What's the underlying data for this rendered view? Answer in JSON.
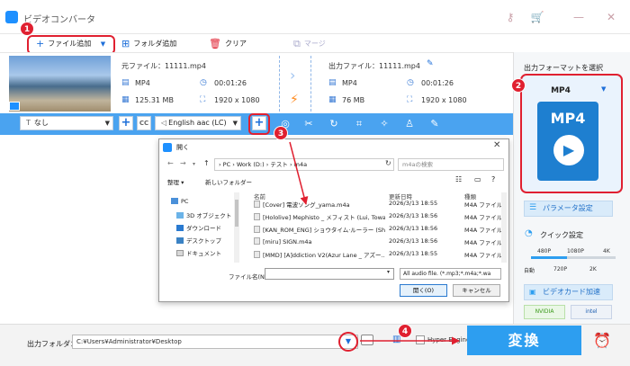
{
  "app": {
    "title": "ビデオコンバータ"
  },
  "window": {
    "minimize": "—",
    "close": "✕"
  },
  "toolbar": {
    "add_file": "ファイル追加",
    "add_folder": "フォルダ追加",
    "clear": "クリア",
    "merge": "マージ"
  },
  "file": {
    "source_label": "元ファイル：11111.mp4",
    "source_format": "MP4",
    "source_duration": "00:01:26",
    "source_size": "125.31 MB",
    "source_resolution": "1920 x 1080",
    "output_label": "出力ファイル：11111.mp4",
    "output_format": "MP4",
    "output_duration": "00:01:26",
    "output_size": "76 MB",
    "output_resolution": "1920 x 1080"
  },
  "editbar": {
    "subtitle": "なし",
    "audio": "English aac (LC)",
    "cc": "CC"
  },
  "output": {
    "folder_label": "出力フォルダ：",
    "path": "C:¥Users¥Administrator¥Desktop",
    "hw_label": "Hyper Engine",
    "convert": "変換"
  },
  "right": {
    "format_title": "出力フォーマットを選択",
    "format_name": "MP4",
    "format_badge": "MP4",
    "param": "パラメータ設定",
    "quick": "クイック設定",
    "ticks_top": [
      "480P",
      "1080P",
      "4K"
    ],
    "ticks_bottom": [
      "自動",
      "720P",
      "2K"
    ],
    "accel": "ビデオカード加速",
    "nvidia": "NVIDIA",
    "intel": "intel"
  },
  "steps": [
    "1",
    "2",
    "3",
    "4"
  ],
  "dialog": {
    "title": "開く",
    "address": "›  PC  ›  Work (D:)  ›  テスト  ›  m4a",
    "search_placeholder": "m4aの検索",
    "organize": "整理 ▾",
    "new_folder": "新しいフォルダー",
    "tree": [
      "PC",
      "3D オブジェクト",
      "ダウンロード",
      "デスクトップ",
      "ドキュメント"
    ],
    "columns": {
      "name": "名前",
      "date": "更新日時",
      "type": "種類"
    },
    "files": [
      {
        "name": "[Cover] 電波ソング_yama.m4a",
        "date": "2026/3/13 18:55",
        "type": "M4A ファイル"
      },
      {
        "name": "[Hololive] Mephisto _ メフィスト (Lui, Towa...",
        "date": "2026/3/13 18:56",
        "type": "M4A ファイル"
      },
      {
        "name": "[KAN_ROM_ENG] ショウタイム·ルーラー (Sh...",
        "date": "2026/3/13 18:56",
        "type": "M4A ファイル"
      },
      {
        "name": "[miru] SIGN.m4a",
        "date": "2026/3/13 18:56",
        "type": "M4A ファイル"
      },
      {
        "name": "[MMD] [A]ddiction V2(Azur Lane _ アズー...",
        "date": "2026/3/13 18:55",
        "type": "M4A ファイル"
      }
    ],
    "filename_label": "ファイル名(N):",
    "filetype": "All audio file. (*.mp3;*.m4a;*.wa",
    "open": "開く(O)",
    "cancel": "キャンセル"
  }
}
